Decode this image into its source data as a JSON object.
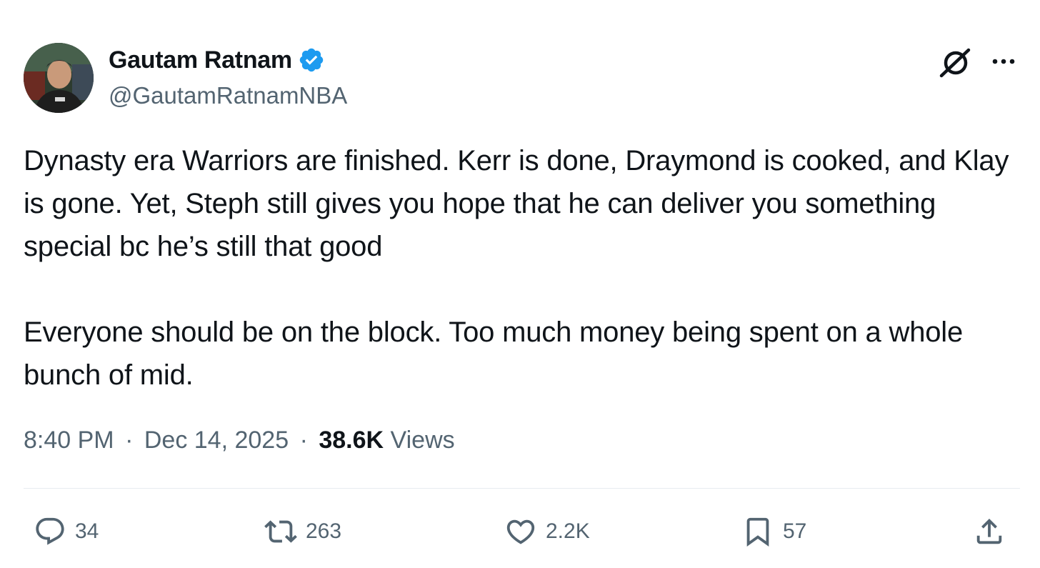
{
  "author": {
    "display_name": "Gautam Ratnam",
    "handle": "@GautamRatnamNBA",
    "verified": true,
    "verified_color": "#1d9bf0"
  },
  "header_icons": [
    "grok-icon",
    "more-icon"
  ],
  "tweet": {
    "paragraphs": [
      "Dynasty era Warriors are finished. Kerr is done, Draymond is cooked, and Klay is gone. Yet, Steph still gives you hope that he can deliver you something special bc he’s still that good",
      "Everyone should be on the block. Too much money being spent on a whole bunch of mid."
    ]
  },
  "meta": {
    "time": "8:40 PM",
    "separator": "·",
    "date": "Dec 14, 2025",
    "views_count": "38.6K",
    "views_label": "Views"
  },
  "actions": {
    "reply": {
      "icon": "reply-icon",
      "count": "34"
    },
    "repost": {
      "icon": "repost-icon",
      "count": "263"
    },
    "like": {
      "icon": "heart-icon",
      "count": "2.2K"
    },
    "bookmark": {
      "icon": "bookmark-icon",
      "count": "57"
    },
    "share": {
      "icon": "share-icon"
    }
  },
  "colors": {
    "text": "#0f1419",
    "secondary": "#536471",
    "divider": "#e7ecf0"
  }
}
